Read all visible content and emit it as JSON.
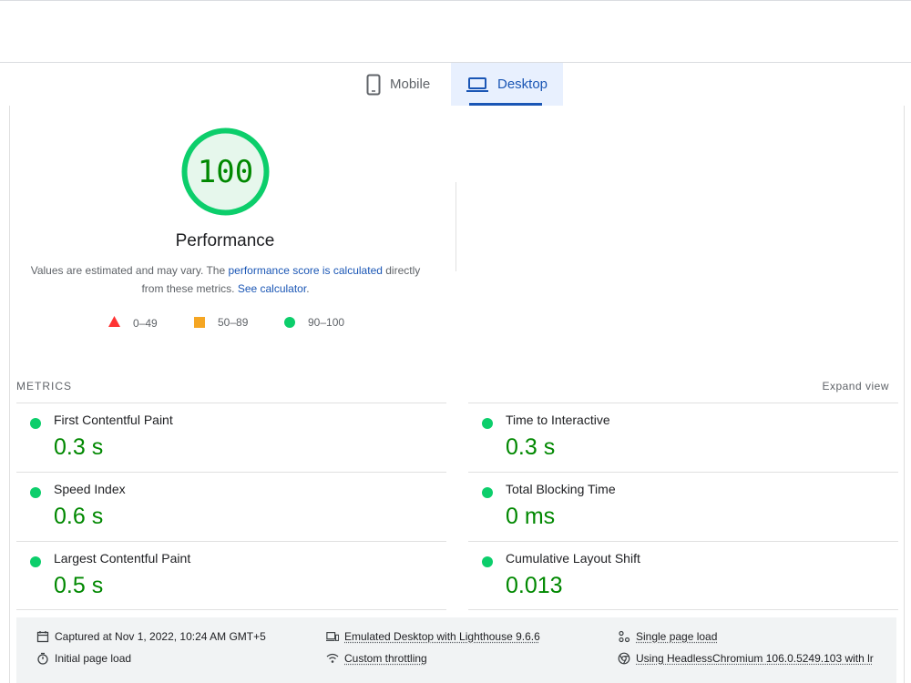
{
  "tabs": {
    "mobile_label": "Mobile",
    "desktop_label": "Desktop"
  },
  "score": {
    "value": "100",
    "title": "Performance",
    "ring_color": "#0cce6b",
    "text_color": "#008800"
  },
  "description": {
    "text1": "Values are estimated and may vary. The ",
    "link1": "performance score is calculated",
    "text2": " directly from these metrics. ",
    "link2": "See calculator",
    "text3": "."
  },
  "legend": [
    {
      "label": "0–49",
      "shape": "triangle",
      "color": "#ff3333"
    },
    {
      "label": "50–89",
      "shape": "square",
      "color": "#f5a623"
    },
    {
      "label": "90–100",
      "shape": "circle",
      "color": "#0cce6b"
    }
  ],
  "metrics": {
    "header": "METRICS",
    "expand_label": "Expand view",
    "items": [
      {
        "label": "First Contentful Paint",
        "value": "0.3 s"
      },
      {
        "label": "Time to Interactive",
        "value": "0.3 s"
      },
      {
        "label": "Speed Index",
        "value": "0.6 s"
      },
      {
        "label": "Total Blocking Time",
        "value": "0 ms"
      },
      {
        "label": "Largest Contentful Paint",
        "value": "0.5 s"
      },
      {
        "label": "Cumulative Layout Shift",
        "value": "0.013"
      }
    ]
  },
  "footer": {
    "captured": "Captured at Nov 1, 2022, 10:24 AM GMT+5",
    "initial": "Initial page load",
    "emulated": "Emulated Desktop with Lighthouse 9.6.6",
    "throttling": "Custom throttling",
    "single": "Single page load",
    "using": "Using HeadlessChromium 106.0.5249.103 with lr"
  }
}
